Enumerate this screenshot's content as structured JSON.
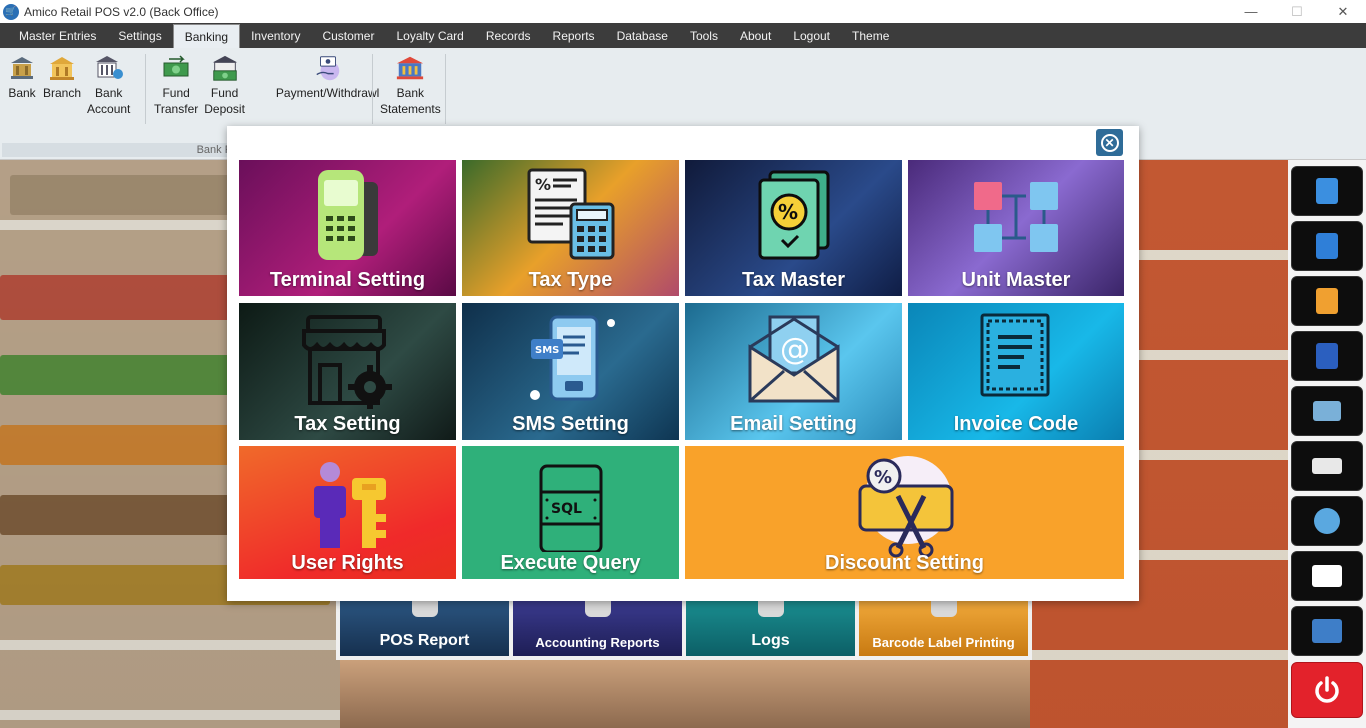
{
  "window": {
    "title": "Amico Retail POS v2.0 (Back Office)",
    "minimize": "—",
    "maximize": "☐",
    "close": "✕"
  },
  "menu": [
    "Master Entries",
    "Settings",
    "Banking",
    "Inventory",
    "Customer",
    "Loyalty Card",
    "Records",
    "Reports",
    "Database",
    "Tools",
    "About",
    "Logout",
    "Theme"
  ],
  "active_menu": "Banking",
  "ribbon": {
    "buttons": [
      {
        "label": "Bank",
        "icon": "bank-icon"
      },
      {
        "label": "Branch",
        "icon": "branch-icon"
      },
      {
        "label": "Bank\nAccount",
        "icon": "bank-account-icon"
      },
      {
        "label": "Fund\nTransfer",
        "icon": "fund-transfer-icon"
      },
      {
        "label": "Fund\nDeposit",
        "icon": "fund-deposit-icon"
      },
      {
        "label": "Payment/Withdrawl",
        "icon": "payment-withdrawl-icon"
      },
      {
        "label": "Bank\nStatements",
        "icon": "bank-statements-icon"
      }
    ],
    "group_caption": "Bank Reco"
  },
  "modal": {
    "close_icon": "close-icon",
    "tiles": [
      {
        "label": "Terminal Setting",
        "icon": "card-terminal-icon",
        "bg": "#8a1a6b"
      },
      {
        "label": "Tax Type",
        "icon": "tax-calculator-icon",
        "bg": "#c9781e"
      },
      {
        "label": "Tax Master",
        "icon": "percent-document-icon",
        "bg": "#1c2a5a"
      },
      {
        "label": "Unit Master",
        "icon": "unit-flow-icon",
        "bg": "#5a3b8a"
      },
      {
        "label": "Tax Setting",
        "icon": "store-gear-icon",
        "bg": "#1e2a28"
      },
      {
        "label": "SMS Setting",
        "icon": "sms-phone-icon",
        "bg": "#1b4a6e"
      },
      {
        "label": "Email Setting",
        "icon": "email-envelope-icon",
        "bg": "#2b8fb8"
      },
      {
        "label": "Invoice Code",
        "icon": "invoice-document-icon",
        "bg": "#0f94c2"
      },
      {
        "label": "User Rights",
        "icon": "user-key-icon",
        "bg": "#f04a1e"
      },
      {
        "label": "Execute Query",
        "icon": "sql-database-icon",
        "bg": "#2fb07a"
      },
      {
        "label": "Discount Setting",
        "icon": "discount-ticket-icon",
        "bg": "#f9a22a"
      }
    ]
  },
  "background_tiles": [
    {
      "label": "POS Report",
      "bg": "#1f3b5e"
    },
    {
      "label": "Accounting Reports",
      "bg": "#2a2a6a"
    },
    {
      "label": "Logs",
      "bg": "#11767d"
    },
    {
      "label": "Barcode Label Printing",
      "bg": "#e0961f"
    }
  ],
  "sidebar": [
    {
      "name": "notepad-icon"
    },
    {
      "name": "notes-icon"
    },
    {
      "name": "calculator-icon"
    },
    {
      "name": "word-icon"
    },
    {
      "name": "system-monitor-icon"
    },
    {
      "name": "keyboard-icon"
    },
    {
      "name": "paint-palette-icon"
    },
    {
      "name": "desktop-icon"
    },
    {
      "name": "control-panel-icon"
    },
    {
      "name": "power-icon"
    }
  ]
}
